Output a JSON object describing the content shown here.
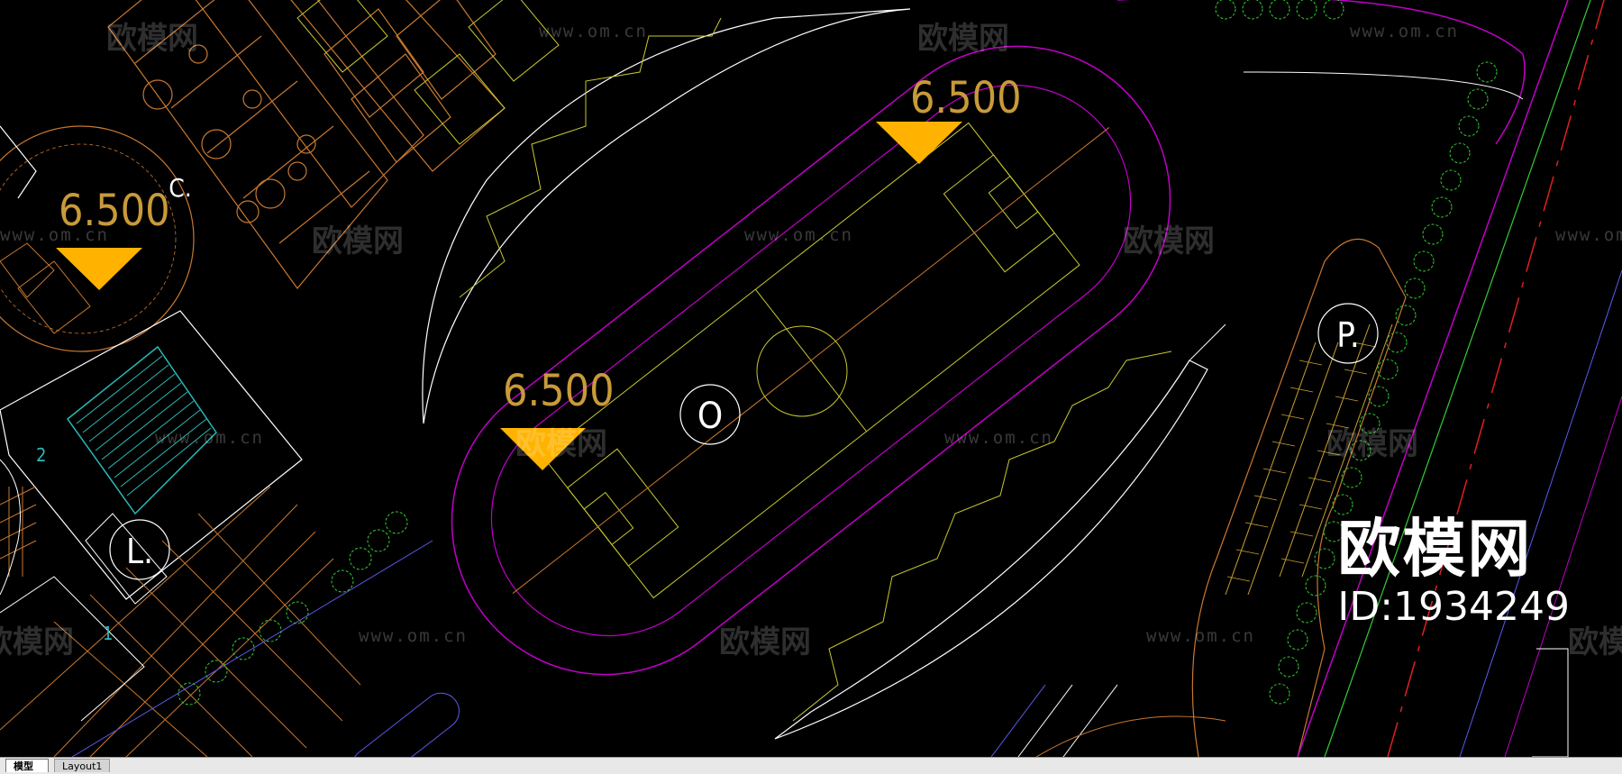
{
  "elevation_markers": [
    {
      "id": "elev-left",
      "value": "6.500"
    },
    {
      "id": "elev-center",
      "value": "6.500"
    },
    {
      "id": "elev-top",
      "value": "6.500"
    }
  ],
  "circle_tags": {
    "o": "O",
    "p": "P.",
    "l": "L.",
    "c": "C."
  },
  "building_numbers": {
    "n2": "2",
    "n1": "1"
  },
  "watermark": {
    "logo_text": "欧模网",
    "url_text": "www.om.cn"
  },
  "brand": {
    "name": "欧模网",
    "id_text": "ID:1934249"
  },
  "tabs": [
    {
      "label": "模型",
      "active": true
    },
    {
      "label": "Layout1",
      "active": false
    }
  ],
  "colors": {
    "background": "#000000",
    "elevation_marker": "#FFB300",
    "elevation_text": "#C89A3A",
    "track": "#C000C8",
    "outline": "#FFFFFF",
    "yellow_line": "#C8C830",
    "orange_line": "#C87830",
    "tree_green": "#33CC33",
    "cyan": "#2AB8B8"
  }
}
